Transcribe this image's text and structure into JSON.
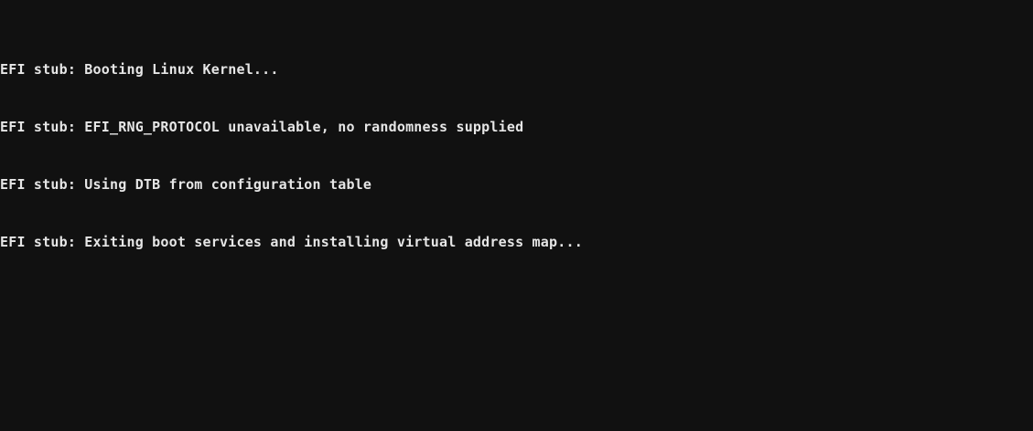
{
  "console": {
    "background": "#111111",
    "foreground": "#e6e6e6",
    "lines": [
      "EFI stub: Booting Linux Kernel...",
      "EFI stub: EFI_RNG_PROTOCOL unavailable, no randomness supplied",
      "EFI stub: Using DTB from configuration table",
      "EFI stub: Exiting boot services and installing virtual address map..."
    ]
  }
}
